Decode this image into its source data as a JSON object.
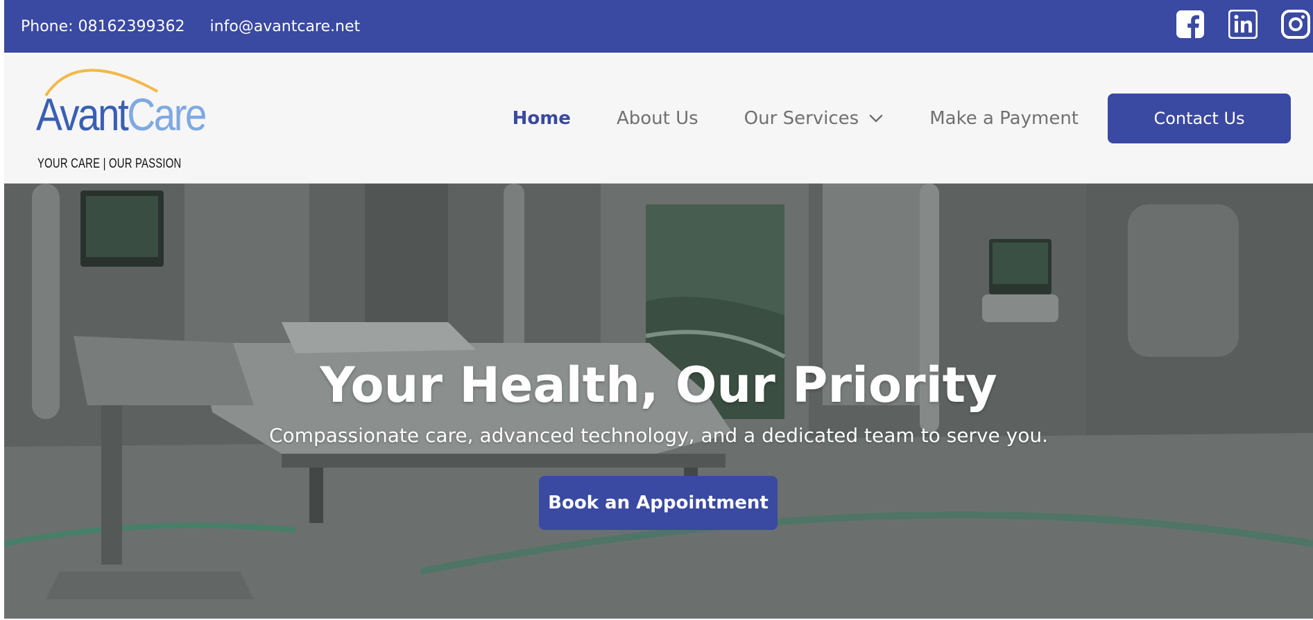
{
  "topbar": {
    "phone": "Phone: 08162399362",
    "email": "info@avantcare.net",
    "bg_color": "#3a49a1",
    "social": [
      {
        "name": "facebook-icon"
      },
      {
        "name": "linkedin-icon"
      },
      {
        "name": "instagram-icon"
      }
    ]
  },
  "logo": {
    "word_part1": "Avant",
    "word_part2": "Care",
    "tagline": "YOUR CARE | OUR PASSION"
  },
  "nav": {
    "items": [
      {
        "label": "Home",
        "active": true
      },
      {
        "label": "About Us"
      },
      {
        "label": "Our Services",
        "has_dropdown": true
      },
      {
        "label": "Make a Payment"
      }
    ],
    "cta": "Contact Us"
  },
  "hero": {
    "title": "Your Health, Our Priority",
    "subtitle": "Compassionate care, advanced technology, and a dedicated team to serve you.",
    "button": "Book an Appointment"
  },
  "colors": {
    "accent": "#3a49a1",
    "nav_text": "#707070",
    "header_bg": "#f6f6f6"
  }
}
